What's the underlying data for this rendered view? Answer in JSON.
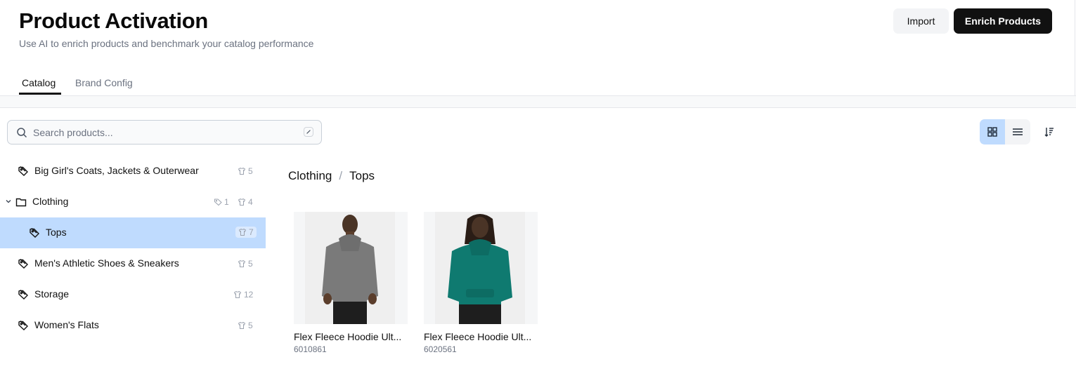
{
  "header": {
    "title": "Product Activation",
    "subtitle": "Use AI to enrich products and benchmark your catalog performance",
    "import_label": "Import",
    "enrich_label": "Enrich Products"
  },
  "tabs": [
    {
      "label": "Catalog",
      "active": true
    },
    {
      "label": "Brand Config",
      "active": false
    }
  ],
  "search": {
    "placeholder": "Search products..."
  },
  "tree": [
    {
      "label": "Big Girl's Coats, Jackets & Outerwear",
      "icon": "tag-icon",
      "products": "5"
    },
    {
      "label": "Clothing",
      "icon": "folder-icon",
      "tags": "1",
      "products": "4",
      "expanded": true
    },
    {
      "label": "Tops",
      "icon": "tag-icon",
      "products": "7",
      "selected": true
    },
    {
      "label": "Men's Athletic Shoes & Sneakers",
      "icon": "tag-icon",
      "products": "5"
    },
    {
      "label": "Storage",
      "icon": "tag-icon",
      "products": "12"
    },
    {
      "label": "Women's Flats",
      "icon": "tag-icon",
      "products": "5"
    }
  ],
  "breadcrumb": {
    "parent": "Clothing",
    "separator": "/",
    "current": "Tops"
  },
  "view": {
    "mode": "grid"
  },
  "products": [
    {
      "name": "Flex Fleece Hoodie Ult...",
      "sku": "6010861",
      "color": "#7a7a7a"
    },
    {
      "name": "Flex Fleece Hoodie Ult...",
      "sku": "6020561",
      "color": "#0f7a70"
    }
  ],
  "colors": {
    "accent": "#bfdbfe",
    "primary_button": "#111111"
  }
}
